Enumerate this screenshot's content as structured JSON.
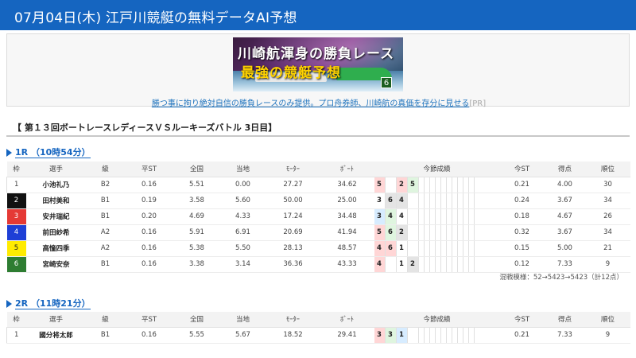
{
  "header": {
    "title": "07月04日(木) 江戸川競艇の無料データAI予想"
  },
  "ad": {
    "banner_line1": "川崎航渾身の勝負レース",
    "banner_line2": "最強の競艇予想",
    "banner_badge": "6",
    "link_text": "勝つ事に拘り絶対自信の勝負レースのみ提供。プロ舟券師、川崎航の真価を存分に見せる",
    "pr": "[PR]"
  },
  "section": {
    "title": "【 第１３回ボートレースレディースＶＳルーキーズバトル 3日目】"
  },
  "columns": [
    "枠",
    "選手",
    "級",
    "平ST",
    "全国",
    "当地",
    "ﾓｰﾀｰ",
    "ﾎﾞｰﾄ",
    "今節成績",
    "今ST",
    "得点",
    "順位"
  ],
  "races": [
    {
      "label": "1R （10時54分）",
      "rows": [
        {
          "waku": "1",
          "name": "小池礼乃",
          "cls": "B2",
          "avg_st": "0.16",
          "zenkoku": "5.51",
          "touchi": "0.00",
          "motor": "27.27",
          "boat": "34.62",
          "results": [
            [
              "5",
              "r1"
            ],
            [
              "",
              ""
            ],
            [
              "2",
              "r1"
            ],
            [
              "5",
              "r3"
            ]
          ],
          "now_st": "0.21",
          "score": "4.00",
          "rank": "30"
        },
        {
          "waku": "2",
          "name": "田村美和",
          "cls": "B1",
          "avg_st": "0.19",
          "zenkoku": "3.58",
          "touchi": "5.60",
          "motor": "50.00",
          "boat": "25.00",
          "results": [
            [
              "3",
              ""
            ],
            [
              "6",
              "rx"
            ],
            [
              "4",
              "rx"
            ],
            [
              "",
              ""
            ]
          ],
          "now_st": "0.24",
          "score": "3.67",
          "rank": "34"
        },
        {
          "waku": "3",
          "name": "安井瑞紀",
          "cls": "B1",
          "avg_st": "0.20",
          "zenkoku": "4.69",
          "touchi": "4.33",
          "motor": "17.24",
          "boat": "34.48",
          "results": [
            [
              "3",
              "r2"
            ],
            [
              "4",
              "r3"
            ],
            [
              "4",
              ""
            ],
            [
              "",
              ""
            ]
          ],
          "now_st": "0.18",
          "score": "4.67",
          "rank": "26"
        },
        {
          "waku": "4",
          "name": "前田紗希",
          "cls": "A2",
          "avg_st": "0.16",
          "zenkoku": "5.91",
          "touchi": "6.91",
          "motor": "20.69",
          "boat": "41.94",
          "results": [
            [
              "5",
              "r1"
            ],
            [
              "6",
              "r3"
            ],
            [
              "2",
              "rx"
            ],
            [
              "",
              ""
            ]
          ],
          "now_st": "0.32",
          "score": "3.67",
          "rank": "34"
        },
        {
          "waku": "5",
          "name": "高憧四季",
          "cls": "A2",
          "avg_st": "0.16",
          "zenkoku": "5.38",
          "touchi": "5.50",
          "motor": "28.13",
          "boat": "48.57",
          "results": [
            [
              "4",
              "r1"
            ],
            [
              "6",
              "r1"
            ],
            [
              "1",
              ""
            ],
            [
              "",
              ""
            ]
          ],
          "now_st": "0.15",
          "score": "5.00",
          "rank": "21"
        },
        {
          "waku": "6",
          "name": "宮崎安奈",
          "cls": "B1",
          "avg_st": "0.16",
          "zenkoku": "3.38",
          "touchi": "3.14",
          "motor": "36.36",
          "boat": "43.33",
          "results": [
            [
              "4",
              "r1"
            ],
            [
              "",
              ""
            ],
            [
              "1",
              ""
            ],
            [
              "2",
              "rx"
            ]
          ],
          "now_st": "0.12",
          "score": "7.33",
          "rank": "9"
        }
      ],
      "note": "混戦模様：52→5423→5423（計12点）"
    },
    {
      "label": "2R （11時21分）",
      "rows": [
        {
          "waku": "1",
          "name": "國分将太郎",
          "cls": "B1",
          "avg_st": "0.16",
          "zenkoku": "5.55",
          "touchi": "5.67",
          "motor": "18.52",
          "boat": "29.41",
          "results": [
            [
              "3",
              "r1"
            ],
            [
              "3",
              "r3"
            ],
            [
              "1",
              "r2"
            ],
            [
              "",
              ""
            ]
          ],
          "now_st": "0.21",
          "score": "7.33",
          "rank": "9"
        }
      ]
    }
  ]
}
